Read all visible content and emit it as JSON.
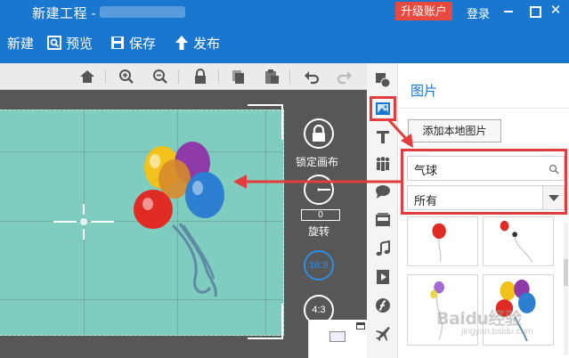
{
  "titlebar": {
    "title": "新建工程 -",
    "upgrade_label": "升级账户",
    "login_label": "登录"
  },
  "toolbar": {
    "new_label": "新建",
    "preview_label": "预览",
    "save_label": "保存",
    "publish_label": "发布"
  },
  "canvas_tools": [
    "home-icon",
    "zoom-in-icon",
    "zoom-out-icon",
    "lock-icon",
    "copy-icon",
    "paste-icon",
    "undo-icon",
    "redo-icon"
  ],
  "stage": {
    "lock_canvas_label": "锁定画布",
    "rotate_value": "0",
    "rotate_label": "旋转",
    "ratio_169": "16:9",
    "ratio_43": "4:3"
  },
  "tool_strip": [
    "shapes-icon",
    "image-icon",
    "text-icon",
    "people-icon",
    "speech-bubble-icon",
    "background-icon",
    "music-icon",
    "video-icon",
    "flash-icon",
    "airplane-icon"
  ],
  "panel": {
    "title": "图片",
    "add_local_label": "添加本地图片",
    "search_value": "气球",
    "filter_value": "所有"
  },
  "watermark": {
    "text": "Baidu经验",
    "sub": "jingyan.baidu.com"
  },
  "colors": {
    "brand_blue": "#1a77cf",
    "upgrade_red": "#e84a3f",
    "canvas_teal": "#7fcdbf",
    "annotation_red": "#e43c3c"
  }
}
